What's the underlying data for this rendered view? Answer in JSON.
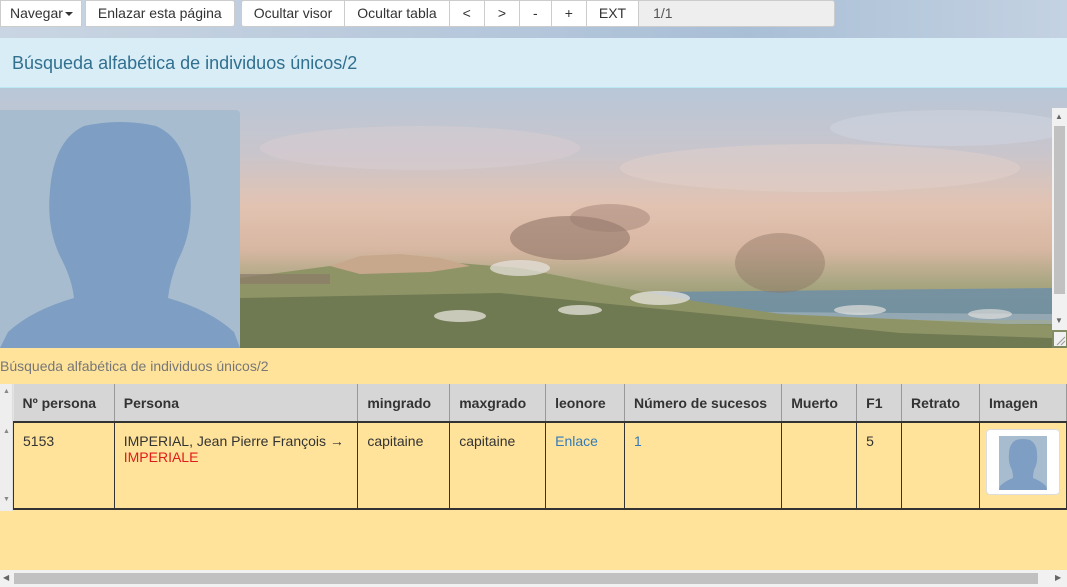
{
  "toolbar": {
    "navigate_label": "Navegar",
    "link_page_label": "Enlazar esta página",
    "hide_viewer_label": "Ocultar visor",
    "hide_table_label": "Ocultar tabla",
    "prev_label": "<",
    "next_label": ">",
    "zoom_out_label": "-",
    "zoom_in_label": "+",
    "ext_label": "EXT",
    "page_indicator": "1/1"
  },
  "page": {
    "title": "Búsqueda alfabética de individuos únicos/2",
    "section_label": "Búsqueda alfabética de individuos únicos/2"
  },
  "table": {
    "columns": [
      "Nº persona",
      "Persona",
      "mingrado",
      "maxgrado",
      "leonore",
      "Número de sucesos",
      "Muerto",
      "F1",
      "Retrato",
      "Imagen"
    ],
    "rows": [
      {
        "numero": "5153",
        "persona_main": "IMPERIAL, Jean Pierre François →",
        "persona_alias": "IMPERIALE",
        "mingrado": "capitaine",
        "maxgrado": "capitaine",
        "leonore": "Enlace",
        "sucesos": "1",
        "muerto": "",
        "f1": "5",
        "retrato": ""
      }
    ]
  },
  "colors": {
    "panel_bg": "#ffe39a",
    "title_bar_bg": "#d9edf7",
    "title_text": "#31708f",
    "link": "#337ab7",
    "alias": "#e01b1b"
  },
  "icons": {
    "avatar": "person-silhouette-icon",
    "caret": "caret-down-icon"
  }
}
